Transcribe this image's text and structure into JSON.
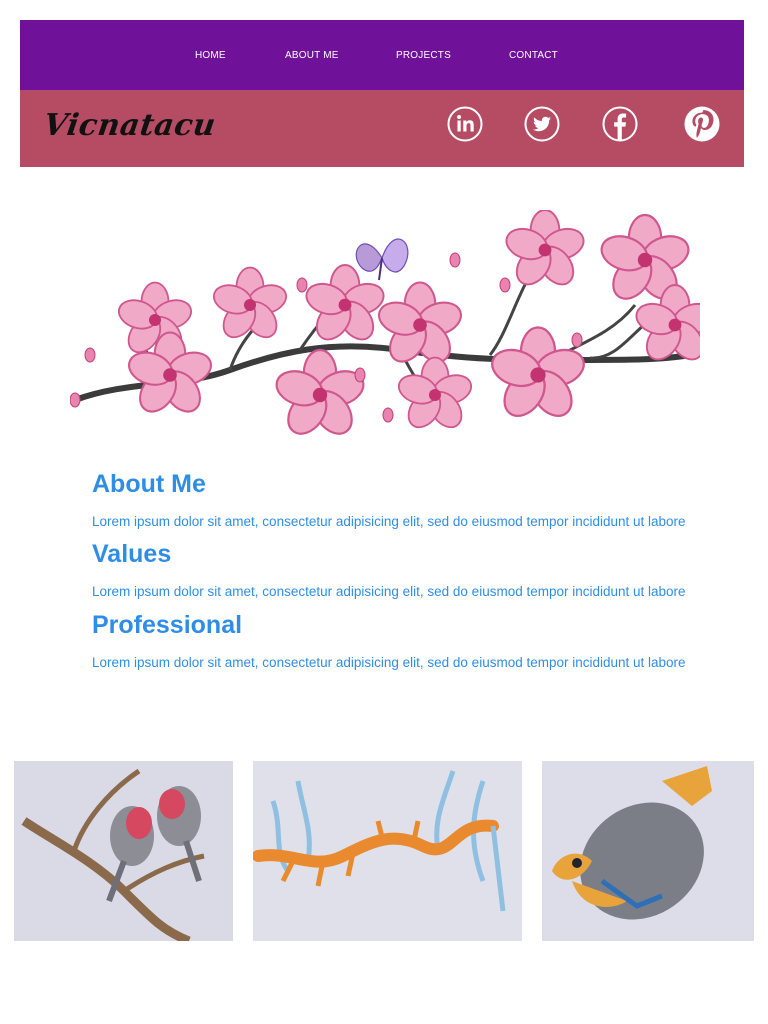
{
  "nav": {
    "items": [
      {
        "label": "HOME"
      },
      {
        "label": "ABOUT ME"
      },
      {
        "label": "PROJECTS"
      },
      {
        "label": "CONTACT"
      }
    ]
  },
  "brand": {
    "logo_text": "Vicnatacu",
    "social_icons": [
      "linkedin-icon",
      "twitter-icon",
      "facebook-icon",
      "pinterest-icon"
    ]
  },
  "hero": {
    "image": "cherry-blossom-branch-with-butterfly-drawing"
  },
  "sections": [
    {
      "title": "About Me",
      "text": "Lorem ipsum dolor sit amet, consectetur adipisicing elit, sed do eiusmod tempor incididunt ut labore"
    },
    {
      "title": "Values",
      "text": "Lorem ipsum dolor sit amet, consectetur adipisicing elit, sed do eiusmod tempor incididunt ut labore"
    },
    {
      "title": "Professional",
      "text": "Lorem ipsum dolor sit amet, consectetur adipisicing elit, sed do eiusmod tempor incididunt ut labore"
    }
  ],
  "gallery": {
    "items": [
      {
        "image": "galah-birds-on-branch-drawing"
      },
      {
        "image": "leafy-sea-dragon-drawing"
      },
      {
        "image": "tropical-fish-drawing"
      }
    ]
  },
  "colors": {
    "nav_background": "#70119a",
    "brand_background": "#b54c63",
    "heading_text": "#2f8de4",
    "nav_text": "#ffffff"
  }
}
